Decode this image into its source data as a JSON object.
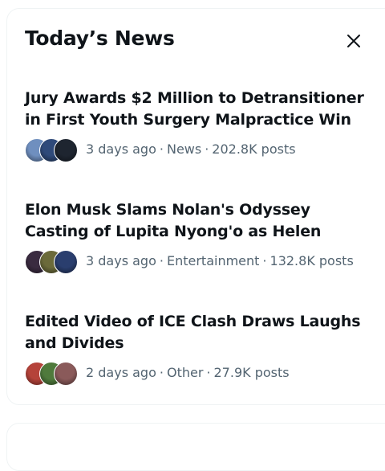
{
  "header": {
    "title": "Today’s News"
  },
  "stories": [
    {
      "headline": "Jury Awards $2 Million to Detransitioner in First Youth Surgery Malpractice Win",
      "time": "3 days ago",
      "category": "News",
      "posts": "202.8K posts",
      "avatar_colors": [
        "#6f8fbf",
        "#2f4a7a",
        "#1e2530"
      ]
    },
    {
      "headline": "Elon Musk Slams Nolan's Odyssey Casting of Lupita Nyong'o as Helen",
      "time": "3 days ago",
      "category": "Entertainment",
      "posts": "132.8K posts",
      "avatar_colors": [
        "#3a2b40",
        "#6b6a3a",
        "#2a3e6e"
      ]
    },
    {
      "headline": "Edited Video of ICE Clash Draws Laughs and Divides",
      "time": "2 days ago",
      "category": "Other",
      "posts": "27.9K posts",
      "avatar_colors": [
        "#b5433a",
        "#4f7a3c",
        "#8a5a5a"
      ]
    }
  ],
  "icons": {
    "close": "close-icon"
  }
}
